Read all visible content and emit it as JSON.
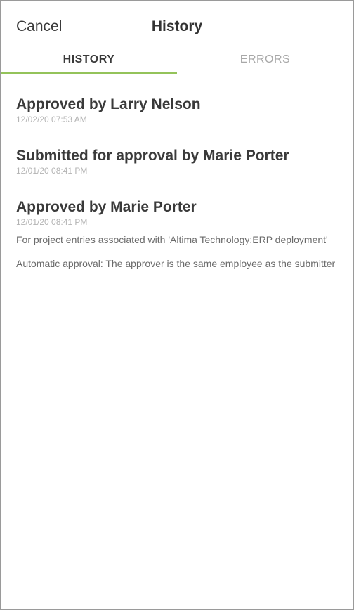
{
  "header": {
    "cancel_label": "Cancel",
    "title": "History"
  },
  "tabs": [
    {
      "label": "HISTORY",
      "active": true
    },
    {
      "label": "ERRORS",
      "active": false
    }
  ],
  "colors": {
    "active_tab_underline": "#94c35a"
  },
  "history": [
    {
      "title": "Approved by Larry Nelson",
      "timestamp": "12/02/20 07:53 AM",
      "notes": []
    },
    {
      "title": "Submitted for approval by Marie Porter",
      "timestamp": "12/01/20 08:41 PM",
      "notes": []
    },
    {
      "title": "Approved by Marie Porter",
      "timestamp": "12/01/20 08:41 PM",
      "notes": [
        "For project entries associated with 'Altima Technology:ERP deployment'",
        "Automatic approval: The approver is the same employee as the submitter"
      ]
    }
  ]
}
